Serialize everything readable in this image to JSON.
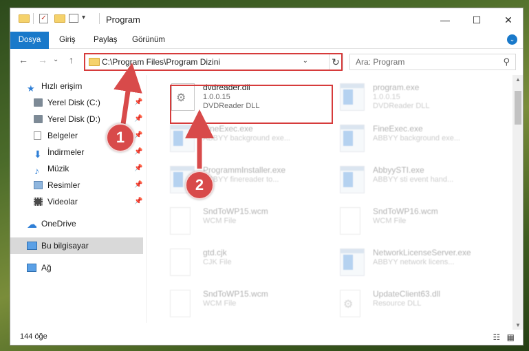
{
  "window": {
    "title": "Program",
    "controls": {
      "minimize": "—",
      "maximize": "☐",
      "close": "✕"
    }
  },
  "ribbon": {
    "tabs": [
      "Dosya",
      "Giriş",
      "Paylaş",
      "Görünüm"
    ],
    "expand_icon": "chevron-down-icon"
  },
  "address_bar": {
    "path": "C:\\Program Files\\Program Dizini",
    "dropdown": "⌄",
    "refresh": "↻"
  },
  "search": {
    "placeholder": "Ara: Program",
    "icon": "search-icon"
  },
  "nav": {
    "back": "←",
    "forward": "→",
    "recent": "⌄",
    "up": "↑"
  },
  "sidebar": {
    "items": [
      {
        "label": "Hızlı erişim",
        "icon": "star-icon",
        "pinned": false
      },
      {
        "label": "Yerel Disk (C:)",
        "icon": "drive-icon",
        "pinned": true
      },
      {
        "label": "Yerel Disk (D:)",
        "icon": "drive-icon",
        "pinned": true
      },
      {
        "label": "Belgeler",
        "icon": "documents-icon",
        "pinned": true
      },
      {
        "label": "İndirmeler",
        "icon": "download-icon",
        "pinned": true
      },
      {
        "label": "Müzik",
        "icon": "music-icon",
        "pinned": true
      },
      {
        "label": "Resimler",
        "icon": "pictures-icon",
        "pinned": true
      },
      {
        "label": "Videolar",
        "icon": "videos-icon",
        "pinned": true
      },
      {
        "label": "OneDrive",
        "icon": "cloud-icon",
        "pinned": false
      },
      {
        "label": "Bu bilgisayar",
        "icon": "computer-icon",
        "pinned": false,
        "selected": true
      },
      {
        "label": "Ağ",
        "icon": "network-icon",
        "pinned": false
      }
    ],
    "pin_glyph": "📌"
  },
  "files": [
    {
      "name": "dvdreader.dll",
      "line2": "1.0.0.15",
      "line3": "DVDReader DLL",
      "type": "dll",
      "highlighted": true
    },
    {
      "name": "program.exe",
      "line2": "1.0.0.15",
      "line3": "DVDReader DLL",
      "type": "exe"
    },
    {
      "name": "FineExec.exe",
      "line2": "ABBYY background exe...",
      "line3": "",
      "type": "app"
    },
    {
      "name": "FineExec.exe",
      "line2": "ABBYY background exe...",
      "line3": "",
      "type": "app"
    },
    {
      "name": "ProgrammInstaller.exe",
      "line2": "ABBYY finereader to...",
      "line3": "",
      "type": "app"
    },
    {
      "name": "AbbyySTI.exe",
      "line2": "ABBYY sti event hand...",
      "line3": "",
      "type": "app"
    },
    {
      "name": "SndToWP15.wcm",
      "line2": "WCM File",
      "line3": "",
      "type": "doc"
    },
    {
      "name": "SndToWP16.wcm",
      "line2": "WCM File",
      "line3": "",
      "type": "doc"
    },
    {
      "name": "gtd.cjk",
      "line2": "CJK File",
      "line3": "",
      "type": "doc"
    },
    {
      "name": "NetworkLicenseServer.exe",
      "line2": "ABBYY network licens...",
      "line3": "",
      "type": "app"
    },
    {
      "name": "SndToWP15.wcm",
      "line2": "WCM File",
      "line3": "",
      "type": "doc"
    },
    {
      "name": "UpdateClient63.dll",
      "line2": "Resource DLL",
      "line3": "",
      "type": "dll"
    }
  ],
  "status": {
    "count": "144 öğe"
  },
  "callouts": [
    "1",
    "2"
  ],
  "colors": {
    "accent": "#1979ca",
    "highlight": "#d63b3b",
    "callout": "#d84a4a"
  }
}
